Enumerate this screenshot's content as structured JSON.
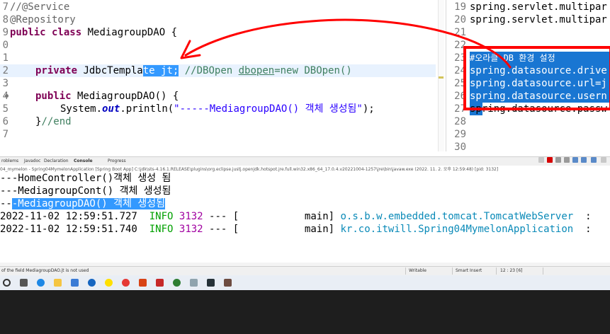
{
  "left_editor": {
    "line_numbers": [
      "7",
      "8",
      "9",
      "0",
      "1",
      "2",
      "3",
      "4",
      "5",
      "6",
      "7"
    ],
    "lines": {
      "l7": "//@Service",
      "l8": "@Repository",
      "l9_kw": "public class",
      "l9_rest": " MediagroupDAO {",
      "l12_kw": "private",
      "l12_type": " JdbcTempla",
      "l12_sel": "te jt;",
      "l12_cm_a": " //DBOpen ",
      "l12_cm_b": "dbopen",
      "l12_cm_c": "=new DBOpen()",
      "l14_kw": "public",
      "l14_rest": " MediagroupDAO() {",
      "l15_a": "System.",
      "l15_out": "out",
      "l15_b": ".println(",
      "l15_str": "\"-----MediagroupDAO() 객체 생성됨\"",
      "l15_c": ");",
      "l16_a": "}",
      "l16_cm": "//end"
    }
  },
  "right_editor": {
    "lines": [
      {
        "num": "19",
        "text": "spring.servlet.multipar"
      },
      {
        "num": "20",
        "text": "spring.servlet.multipar"
      },
      {
        "num": "21",
        "text": ""
      },
      {
        "num": "22",
        "text": ""
      },
      {
        "num": "23",
        "text": "#오라클 DB 환경 설정"
      },
      {
        "num": "24",
        "text": "spring.datasource.drive"
      },
      {
        "num": "25",
        "text": "spring.datasource.url=j"
      },
      {
        "num": "26",
        "text": "spring.datasource.usern"
      },
      {
        "num": "27",
        "text": "spring.datasource.passw"
      },
      {
        "num": "28",
        "text": ""
      },
      {
        "num": "29",
        "text": ""
      },
      {
        "num": "30",
        "text": ""
      }
    ]
  },
  "console": {
    "tabs": [
      "roblems",
      "Javadoc",
      "Declaration",
      "Console",
      "Progress"
    ],
    "path": "04_mymelon - Spring04MymelonApplication [Spring Boot App] C:\\jdk\\sts-4.16.1.RELEASE\\plugins\\org.eclipse.justj.openjdk.hotspot.jre.full.win32.x86_64_17.0.4.v20221004-1257\\jre\\bin\\javaw.exe (2022. 11. 2. 오후 12:59:48) [pid: 3132]",
    "lines": [
      "---HomeController()객체 생성 됨",
      "---MediagroupCont() 객체 생성됨",
      "-MediagroupDAO() 객체 생성됨"
    ],
    "line3_prefix": "--",
    "log": [
      {
        "ts": "2022-11-02 12:59:51.727",
        "level": "INFO",
        "pid": "3132",
        "sep": " --- [",
        "thread": "main]",
        "logger": "o.s.b.w.embedded.tomcat.TomcatWebServer",
        "tail": "  :"
      },
      {
        "ts": "2022-11-02 12:59:51.740",
        "level": "INFO",
        "pid": "3132",
        "sep": " --- [",
        "thread": "main]",
        "logger": "kr.co.itwill.Spring04MymelonApplication",
        "tail": "  :"
      }
    ]
  },
  "statusbar": {
    "message": "of the field MediagroupDAO.jt is not used",
    "writable": "Writable",
    "insert": "Smart Insert",
    "position": "12 : 23 [6]"
  },
  "taskbar": {
    "icons": [
      "search-icon",
      "taskview-icon",
      "edge-icon",
      "explorer-icon",
      "store-icon",
      "mail-icon",
      "kakaotalk-icon",
      "chrome-icon",
      "powerpoint-icon",
      "sts-icon",
      "whale-icon",
      "app-icon",
      "sts-folder-icon",
      "terminal-icon",
      "game-icon"
    ]
  },
  "colors": {
    "keyword": "#7f0055",
    "comment": "#3f7f5f",
    "string": "#2a00ff",
    "selection": "#3399ff",
    "annotation_red": "#ff0000",
    "info_green": "#00a000",
    "logger_blue": "#0a8ab8"
  }
}
